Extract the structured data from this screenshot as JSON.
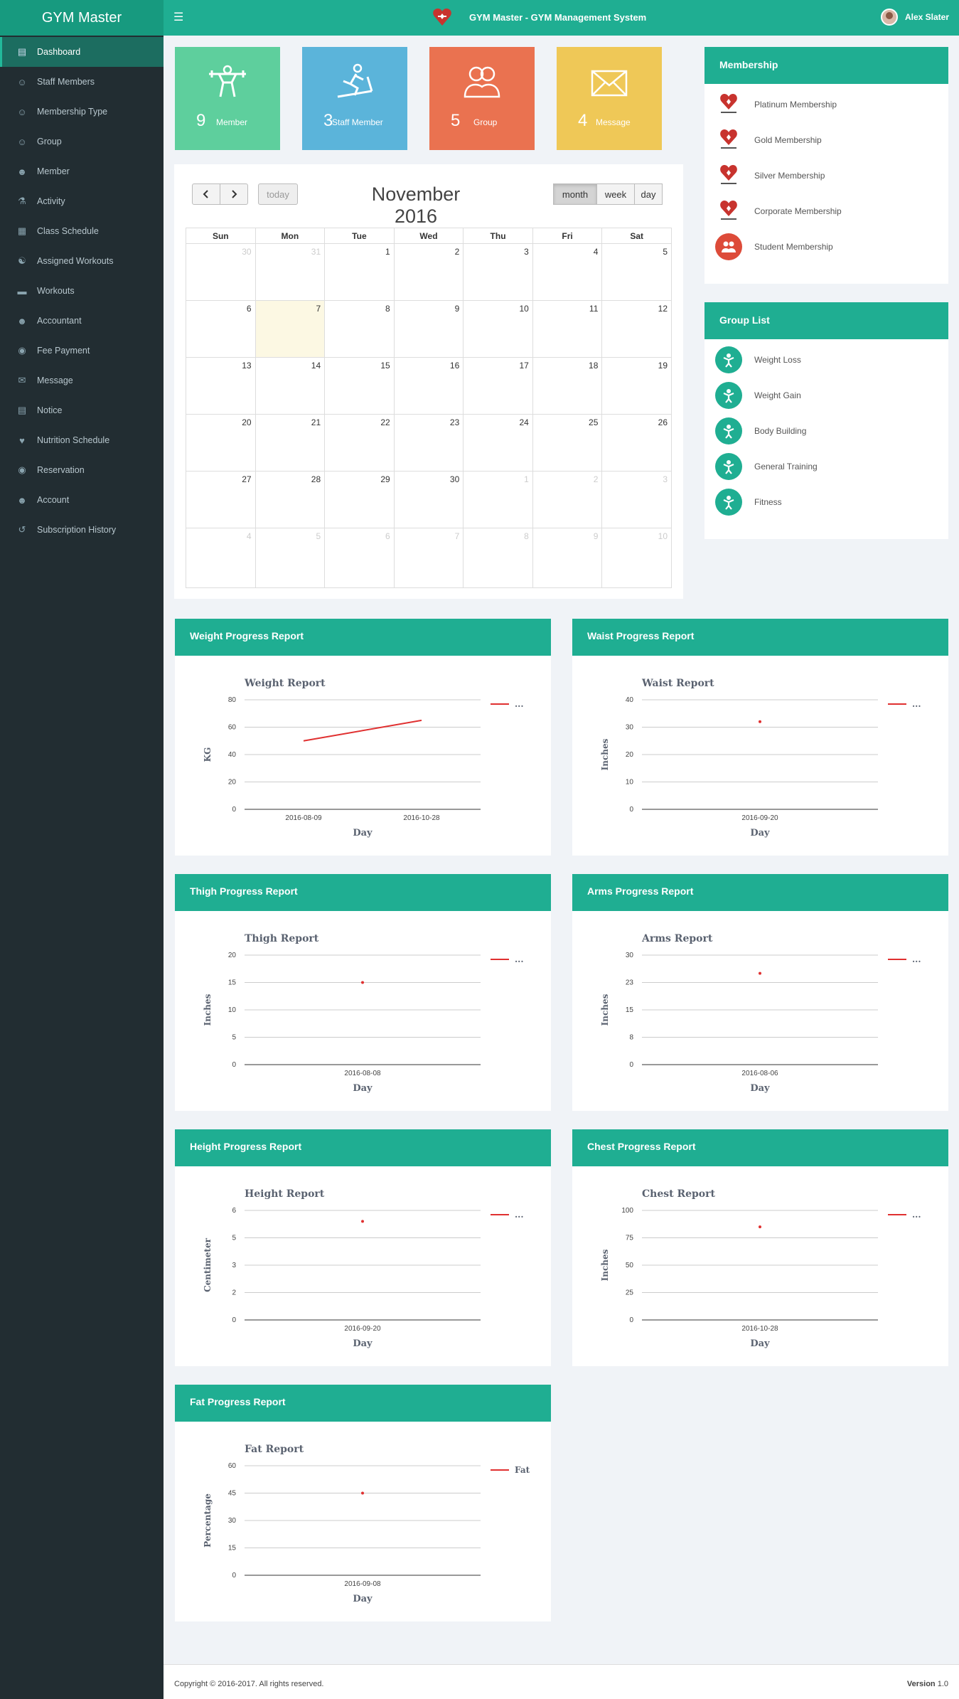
{
  "brand": "GYM Master",
  "topbar": {
    "title": "GYM Master - GYM Management System",
    "user": "Alex Slater",
    "menu_icon": "hamburger-icon"
  },
  "sidebar": {
    "items": [
      {
        "label": "Dashboard",
        "icon": "dashboard-icon",
        "active": true
      },
      {
        "label": "Staff Members",
        "icon": "users-icon"
      },
      {
        "label": "Membership Type",
        "icon": "group-icon"
      },
      {
        "label": "Group",
        "icon": "group-icon"
      },
      {
        "label": "Member",
        "icon": "user-icon"
      },
      {
        "label": "Activity",
        "icon": "bicycle-icon"
      },
      {
        "label": "Class Schedule",
        "icon": "calendar-icon"
      },
      {
        "label": "Assigned Workouts",
        "icon": "workout-icon"
      },
      {
        "label": "Workouts",
        "icon": "dumbbell-icon"
      },
      {
        "label": "Accountant",
        "icon": "user-tie-icon"
      },
      {
        "label": "Fee Payment",
        "icon": "payment-icon"
      },
      {
        "label": "Message",
        "icon": "envelope-icon"
      },
      {
        "label": "Notice",
        "icon": "notice-icon"
      },
      {
        "label": "Nutrition Schedule",
        "icon": "heart-icon"
      },
      {
        "label": "Reservation",
        "icon": "reservation-icon"
      },
      {
        "label": "Account",
        "icon": "account-icon"
      },
      {
        "label": "Subscription History",
        "icon": "history-icon"
      }
    ]
  },
  "stats": [
    {
      "count": "9",
      "label": "Member",
      "color": "#5ecf9d",
      "icon": "weightlifter-icon"
    },
    {
      "count": "3",
      "label": "Staff Member",
      "color": "#5bb4da",
      "icon": "treadmill-icon"
    },
    {
      "count": "5",
      "label": "Group",
      "color": "#ea7250",
      "icon": "group-icon"
    },
    {
      "count": "4",
      "label": "Message",
      "color": "#efc857",
      "icon": "envelope-icon"
    }
  ],
  "calendar": {
    "title": "November 2016",
    "today_label": "today",
    "views": [
      "month",
      "week",
      "day"
    ],
    "active_view": "month",
    "weekdays": [
      "Sun",
      "Mon",
      "Tue",
      "Wed",
      "Thu",
      "Fri",
      "Sat"
    ],
    "weeks": [
      [
        "30",
        "31",
        "1",
        "2",
        "3",
        "4",
        "5"
      ],
      [
        "6",
        "7",
        "8",
        "9",
        "10",
        "11",
        "12"
      ],
      [
        "13",
        "14",
        "15",
        "16",
        "17",
        "18",
        "19"
      ],
      [
        "20",
        "21",
        "22",
        "23",
        "24",
        "25",
        "26"
      ],
      [
        "27",
        "28",
        "29",
        "30",
        "1",
        "2",
        "3"
      ],
      [
        "4",
        "5",
        "6",
        "7",
        "8",
        "9",
        "10"
      ]
    ],
    "other_month": [
      [
        0,
        0
      ],
      [
        0,
        1
      ],
      [
        4,
        4
      ],
      [
        4,
        5
      ],
      [
        4,
        6
      ],
      [
        5,
        0
      ],
      [
        5,
        1
      ],
      [
        5,
        2
      ],
      [
        5,
        3
      ],
      [
        5,
        4
      ],
      [
        5,
        5
      ],
      [
        5,
        6
      ]
    ],
    "today_cell": [
      1,
      1
    ]
  },
  "membership": {
    "title": "Membership",
    "items": [
      "Platinum Membership",
      "Gold Membership",
      "Silver Membership",
      "Corporate Membership",
      "Student Membership"
    ]
  },
  "group_list": {
    "title": "Group List",
    "items": [
      "Weight Loss",
      "Weight Gain",
      "Body Building",
      "General Training",
      "Fitness"
    ]
  },
  "reports": [
    {
      "panel_title": "Weight Progress Report",
      "chart_data": {
        "type": "line",
        "title": "Weight Report",
        "xlabel": "Day",
        "ylabel": "KG",
        "ylim": [
          0,
          80
        ],
        "yticks": [
          "0",
          "20",
          "40",
          "60",
          "80"
        ],
        "x": [
          "2016-08-09",
          "2016-10-28"
        ],
        "series": [
          {
            "values": [
              50,
              65
            ]
          }
        ],
        "legend": "...",
        "color": "#e03030"
      }
    },
    {
      "panel_title": "Waist Progress Report",
      "chart_data": {
        "type": "line",
        "title": "Waist Report",
        "xlabel": "Day",
        "ylabel": "Inches",
        "ylim": [
          0,
          40
        ],
        "yticks": [
          "0",
          "10",
          "20",
          "30",
          "40"
        ],
        "x": [
          "2016-09-20"
        ],
        "series": [
          {
            "values": [
              32
            ]
          }
        ],
        "legend": "...",
        "color": "#e03030"
      }
    },
    {
      "panel_title": "Thigh Progress Report",
      "chart_data": {
        "type": "line",
        "title": "Thigh Report",
        "xlabel": "Day",
        "ylabel": "Inches",
        "ylim": [
          0,
          20
        ],
        "yticks": [
          "0",
          "5",
          "10",
          "15",
          "20"
        ],
        "x": [
          "2016-08-08"
        ],
        "series": [
          {
            "values": [
              15
            ]
          }
        ],
        "legend": "...",
        "color": "#e03030"
      }
    },
    {
      "panel_title": "Arms Progress Report",
      "chart_data": {
        "type": "line",
        "title": "Arms Report",
        "xlabel": "Day",
        "ylabel": "Inches",
        "ylim": [
          0,
          30
        ],
        "yticks": [
          "0",
          "8",
          "15",
          "23",
          "30"
        ],
        "x": [
          "2016-08-06"
        ],
        "series": [
          {
            "values": [
              25
            ]
          }
        ],
        "legend": "...",
        "color": "#e03030"
      }
    },
    {
      "panel_title": "Height Progress Report",
      "chart_data": {
        "type": "line",
        "title": "Height Report",
        "xlabel": "Day",
        "ylabel": "Centimeter",
        "ylim": [
          0,
          6
        ],
        "yticks": [
          "0",
          "2",
          "3",
          "5",
          "6"
        ],
        "x": [
          "2016-09-20"
        ],
        "series": [
          {
            "values": [
              5.4
            ]
          }
        ],
        "legend": "...",
        "color": "#e03030"
      }
    },
    {
      "panel_title": "Chest Progress Report",
      "chart_data": {
        "type": "line",
        "title": "Chest Report",
        "xlabel": "Day",
        "ylabel": "Inches",
        "ylim": [
          0,
          100
        ],
        "yticks": [
          "0",
          "25",
          "50",
          "75",
          "100"
        ],
        "x": [
          "2016-10-28"
        ],
        "series": [
          {
            "values": [
              85
            ]
          }
        ],
        "legend": "...",
        "color": "#e03030"
      }
    },
    {
      "panel_title": "Fat Progress Report",
      "chart_data": {
        "type": "line",
        "title": "Fat Report",
        "xlabel": "Day",
        "ylabel": "Percentage",
        "ylim": [
          0,
          60
        ],
        "yticks": [
          "0",
          "15",
          "30",
          "45",
          "60"
        ],
        "x": [
          "2016-09-08"
        ],
        "series": [
          {
            "values": [
              45
            ]
          }
        ],
        "legend": "Fat",
        "color": "#e03030"
      }
    }
  ],
  "footer": {
    "copyright": "Copyright © 2016-2017. All rights reserved.",
    "version_label": "Version",
    "version": "1.0"
  }
}
